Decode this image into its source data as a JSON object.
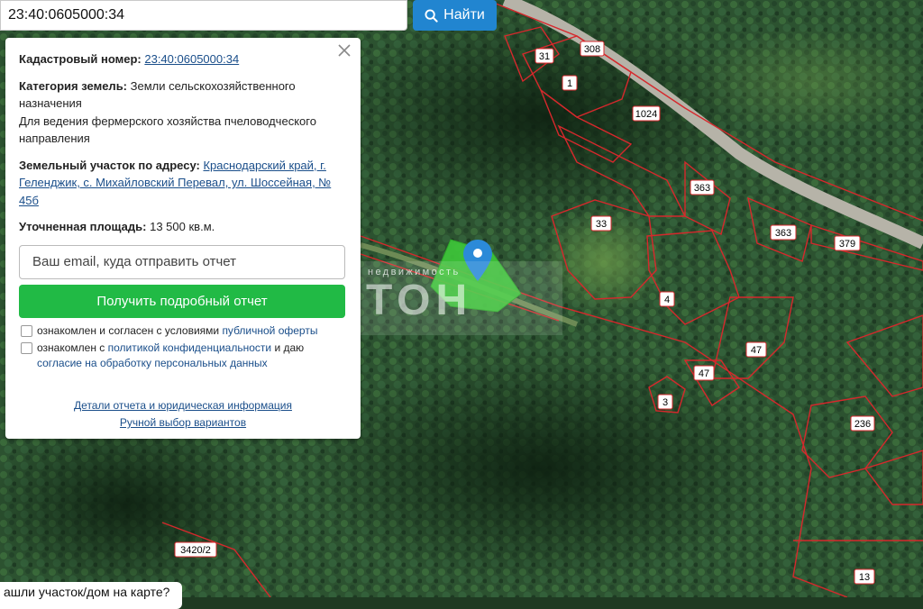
{
  "search": {
    "value": "23:40:0605000:34",
    "button_label": "Найти",
    "button_icon": "search-icon"
  },
  "panel": {
    "cadastral_label": "Кадастровый номер:",
    "cadastral_value": "23:40:0605000:34",
    "category_label": "Категория земель:",
    "category_value": "Земли сельскохозяйственного назначения",
    "usage": "Для ведения фермерского хозяйства пчеловодческого направления",
    "address_label": "Земельный участок по адресу:",
    "address_value": "Краснодарский край, г. Геленджик, с. Михайловский Перевал, ул. Шоссейная, № 45б",
    "area_label": "Уточненная площадь:",
    "area_value": "13 500 кв.м.",
    "email_placeholder": "Ваш email, куда отправить отчет",
    "report_button": "Получить подробный отчет",
    "consent1_text": "ознакомлен и согласен с условиями ",
    "consent1_link": "публичной оферты",
    "consent2_text": "ознакомлен с ",
    "consent2_link": "политикой конфиденциальности",
    "consent2_mid": " и даю ",
    "consent2_link2": "согласие на обработку персональных данных",
    "details_link": "Детали отчета и юридическая информация",
    "manual_link": "Ручной выбор вариантов"
  },
  "hint": "ашли участок/дом на карте?",
  "watermark": {
    "small": "недвижимость",
    "big": "ТОН"
  },
  "parcel_labels": [
    "308",
    "31",
    "1",
    "1024",
    "363",
    "363",
    "379",
    "33",
    "4",
    "47",
    "47",
    "3",
    "236",
    "3420/2",
    "13"
  ],
  "colors": {
    "boundary": "#d6282c",
    "selected": "#3ec93a",
    "button": "#2185d0",
    "report_button": "#21ba45",
    "marker": "#2b8ad8"
  }
}
